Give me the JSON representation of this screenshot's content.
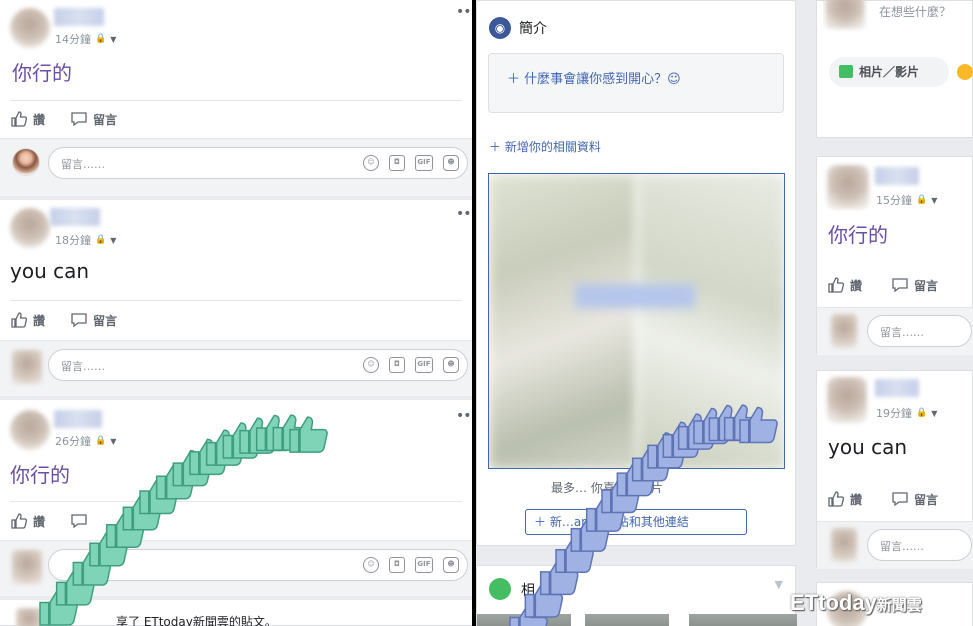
{
  "left_posts": [
    {
      "time": "14分鐘",
      "text": "你行的",
      "style": "purple"
    },
    {
      "time": "18分鐘",
      "text": "you can",
      "style": "black"
    },
    {
      "time": "26分鐘",
      "text": "你行的",
      "style": "purple"
    }
  ],
  "actions": {
    "like": "讚",
    "comment": "留言"
  },
  "comment_placeholder": "留言……",
  "comment_icons": {
    "gif": "GIF"
  },
  "share_text": "享了 ETtoday新聞雲的貼文。",
  "intro": {
    "title": "簡介",
    "happy_prompt": "什麼事會讓你感到開心？☺",
    "add_info": "新增你的相關資料",
    "fav_photos": "最多…    你喜愛的相片",
    "other_links": "新…am、網站和其他連結"
  },
  "photos_label": "相",
  "compose": {
    "placeholder": "在想些什麼？",
    "photo_video": "相片／影片"
  },
  "right_posts": [
    {
      "time": "15分鐘",
      "text": "你行的",
      "style": "purple"
    },
    {
      "time": "19分鐘",
      "text": "you can",
      "style": "black"
    }
  ],
  "right_comment_placeholder": "留言……",
  "watermark": {
    "brand": "ETtoday",
    "suffix": "新聞雲"
  },
  "colors": {
    "link_blue": "#4267b2",
    "purple_text": "#6b4fa3",
    "thumb_green": "#5cc3a1",
    "thumb_blue": "#8aa4d6"
  }
}
